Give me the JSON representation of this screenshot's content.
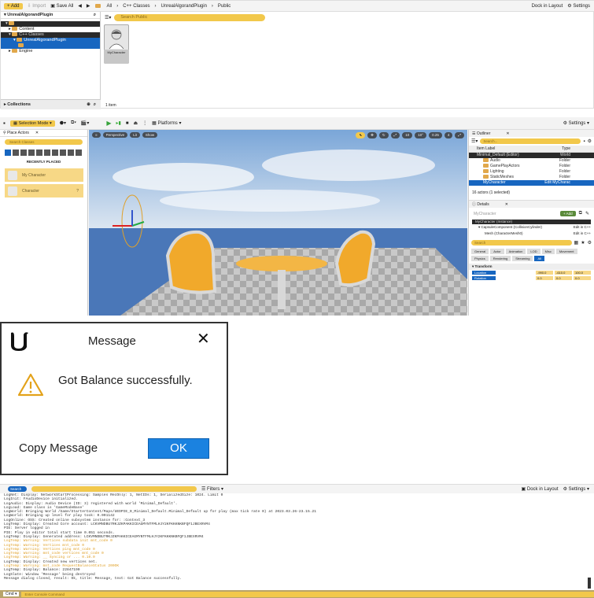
{
  "content_browser": {
    "toolbar": {
      "add": "+ Add",
      "import": "Import",
      "save_all": "Save All",
      "all": "All",
      "cpp_classes": "C++ Classes",
      "plugin": "UnrealAlgorandPlugin",
      "public": "Public",
      "dock": "Dock in Layout",
      "settings": "Settings"
    },
    "sidebar_title": "UnrealAlgorandPlugin",
    "tree": [
      "Content",
      "C++ Classes",
      "UnrealAlgorandPlugin",
      "Engine"
    ],
    "search_placeholder": "Search Public",
    "asset_label": "MyCharacter",
    "collections": "Collections",
    "item_count": "1 item"
  },
  "level_editor": {
    "mode": "Selection Mode",
    "platforms": "Platforms",
    "settings": "Settings",
    "place_actors": {
      "title": "Place Actors",
      "search": "Search Classes",
      "recent": "RECENTLY PLACED",
      "items": [
        "My Character",
        "Character"
      ]
    },
    "viewport": {
      "perspective": "Perspective",
      "lit": "Lit",
      "show": "Show",
      "grid": "10",
      "angle": "10°",
      "scale": "0.25",
      "cam": "4"
    },
    "outliner": {
      "title": "Outliner",
      "search": "Search...",
      "col_label": "Item Label",
      "col_type": "Type",
      "rows": [
        {
          "label": "Minimal_Default (Editor)",
          "type": "World"
        },
        {
          "label": "Audio",
          "type": "Folder"
        },
        {
          "label": "GamePlayActors",
          "type": "Folder"
        },
        {
          "label": "Lighting",
          "type": "Folder"
        },
        {
          "label": "StaticMeshes",
          "type": "Folder"
        },
        {
          "label": "MyCharacter",
          "type": "Edit MyCharac"
        }
      ],
      "status": "16 actors (1 selected)"
    },
    "details": {
      "title": "Details",
      "actor": "MyCharacter",
      "add": "+ Add",
      "components": [
        {
          "label": "MyCharacter (Instance)",
          "type": ""
        },
        {
          "label": "CapsuleComponent (CollisionCylinder)",
          "type": "Edit in C++"
        },
        {
          "label": "Mesh (CharacterMesh0)",
          "type": "Edit in C++"
        }
      ],
      "search": "Search",
      "filters": [
        "General",
        "Actor",
        "Animation",
        "LOD",
        "Misc",
        "Movement",
        "Physics",
        "Rendering",
        "Streaming",
        "All"
      ],
      "transform": "Transform",
      "location": "Location",
      "rotation": "Rotation",
      "loc_values": [
        "-990.0",
        "-610.0",
        "100.0"
      ],
      "rot_values": [
        "0.0",
        "0.0",
        "0.0"
      ]
    }
  },
  "dialog": {
    "title": "Message",
    "message": "Got Balance successfully.",
    "copy": "Copy Message",
    "ok": "OK"
  },
  "output_log": {
    "search": "Search Log",
    "filters": "Filters",
    "dock": "Dock in Layout",
    "settings": "Settings",
    "cmd_type": "Cmd",
    "cmd_placeholder": "Enter Console Command",
    "lines": [
      {
        "t": "LogNet: Display: NetworkStartProcessing: Samples RecOnly: 1, NetIDs: 1, SerializedSize: 1024. Limit 0",
        "w": false
      },
      {
        "t": "LogInit: FAudioDevice initialized.",
        "w": false
      },
      {
        "t": "LogAudio: Display: Audio Device (ID: 3) registered with world 'Minimal_Default'.",
        "w": false
      },
      {
        "t": "LogLoad: Game class is 'GameModeBase'",
        "w": false
      },
      {
        "t": "LogWorld: Bringing World /Game/StarterContent/Maps/UEDPIE_0_Minimal_Default.Minimal_Default up for play (max tick rate 0) at 2023.03.26-23.15.21",
        "w": false
      },
      {
        "t": "LogWorld: Bringing up level for play took: 0.001142",
        "w": false
      },
      {
        "t": "LogOnline: OSS: Created online subsystem instance for: :Context_3",
        "w": false
      },
      {
        "t": "LogTemp: Display: Created Core account: LCKVMNDBU7RKJZKPAKKICEAGMYNTFMLHJY2KFKKKNKBFQF1JBEXRVM4",
        "w": false
      },
      {
        "t": "PIE: Server logged in",
        "w": false
      },
      {
        "t": "PIE: Play in editor total start time 0.051 seconds.",
        "w": false
      },
      {
        "t": "LogTemp: Display: Generated address: LCKVMNDBU7RKJZKPAKKICEAGMYNTFMLHJY2KFKKKNKBFQF1JBEXRVM4",
        "w": false
      },
      {
        "t": "LogTemp: Warning: Vertices subdata init mnt_code 0",
        "w": true
      },
      {
        "t": "LogTemp: Warning: Vertices mnt_code 0",
        "w": true
      },
      {
        "t": "LogTemp: Warning: Vertices ping mnt_code 0",
        "w": true
      },
      {
        "t": "LogTemp: Warning: mnt_code vertices mnt_code 0",
        "w": true
      },
      {
        "t": "LogTemp: Warning: __ Syncing or ... 0.10.0",
        "w": true
      },
      {
        "t": "LogTemp: Display: Created new vertices net.",
        "w": false
      },
      {
        "t": "LogTemp: Warning: mnt_code RequestBalanceStatus 200OK",
        "w": true
      },
      {
        "t": "LogTemp: Display: Balance: 22847190",
        "w": false
      },
      {
        "t": "LogSlate: Window 'Message' being destroyed",
        "w": false
      },
      {
        "t": "Message dialog closed, result: Ok, title: Message, text: Got Balance successfully.",
        "w": false
      }
    ]
  },
  "colors": {
    "accent": "#f2c84b",
    "select": "#1766c0",
    "ok_button": "#1b82e0",
    "warn": "#e0a12a"
  }
}
